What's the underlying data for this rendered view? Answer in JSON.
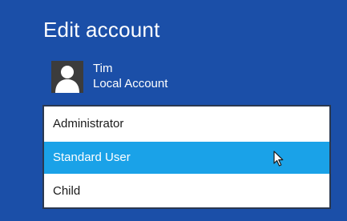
{
  "page": {
    "title": "Edit account"
  },
  "account": {
    "name": "Tim",
    "type": "Local Account"
  },
  "dropdown": {
    "options": [
      {
        "label": "Administrator",
        "selected": false
      },
      {
        "label": "Standard User",
        "selected": true
      },
      {
        "label": "Child",
        "selected": false
      }
    ]
  },
  "colors": {
    "background": "#1b4fa8",
    "highlight": "#1aa2e8",
    "avatar_bg": "#3c3c3c"
  },
  "icons": {
    "avatar": "user-silhouette-icon",
    "cursor": "mouse-pointer-icon"
  }
}
